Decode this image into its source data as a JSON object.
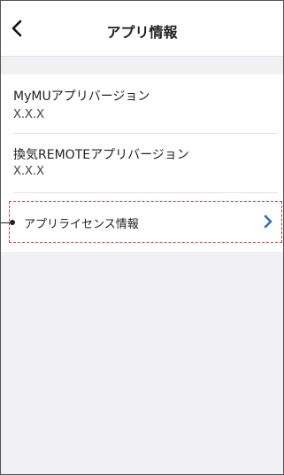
{
  "header": {
    "title": "アプリ情報",
    "back_icon": "chevron-left-icon"
  },
  "info_list": {
    "items": [
      {
        "label": "MyMUアプリバージョン",
        "value": "X.X.X"
      },
      {
        "label": "換気REMOTEアプリバージョン",
        "value": "X.X.X"
      }
    ],
    "license": {
      "label": "アプリライセンス情報",
      "icon": "chevron-right-icon"
    }
  },
  "colors": {
    "accent": "#2a6fc4",
    "highlight_dashed": "#d9362f",
    "background": "#f1f1f3"
  }
}
